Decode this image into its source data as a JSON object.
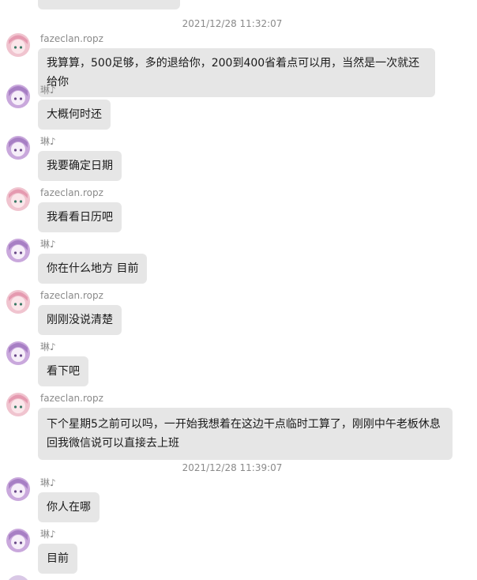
{
  "chat": {
    "timestamps": [
      "2021/12/28 11:32:07",
      "2021/12/28 11:39:07"
    ],
    "messages": [
      {
        "sender": "fazeclan.ropz",
        "text": "我算算，500足够，多的退给你，200到400省着点可以用，当然是一次就还给你"
      },
      {
        "sender": "琳♪",
        "text": "大概何时还"
      },
      {
        "sender": "琳♪",
        "text": "我要确定日期"
      },
      {
        "sender": "fazeclan.ropz",
        "text": "我看看日历吧"
      },
      {
        "sender": "琳♪",
        "text": "你在什么地方 目前"
      },
      {
        "sender": "fazeclan.ropz",
        "text": "刚刚没说清楚"
      },
      {
        "sender": "琳♪",
        "text": "看下吧"
      },
      {
        "sender": "fazeclan.ropz",
        "text": "下个星期5之前可以吗，一开始我想着在这边干点临时工算了，刚刚中午老板休息回我微信说可以直接去上班"
      },
      {
        "sender": "琳♪",
        "text": "你人在哪"
      },
      {
        "sender": "琳♪",
        "text": "目前"
      }
    ]
  },
  "colors": {
    "bubble": "#e6e6e6",
    "meta_text": "#8a8a8a",
    "avatar_pink_hair": "#f0c4cf",
    "avatar_purple_hair": "#c9a8dc"
  },
  "icons": {
    "fazeclan": "pink-hair-anime-avatar-icon",
    "lin": "purple-hair-anime-avatar-icon"
  }
}
